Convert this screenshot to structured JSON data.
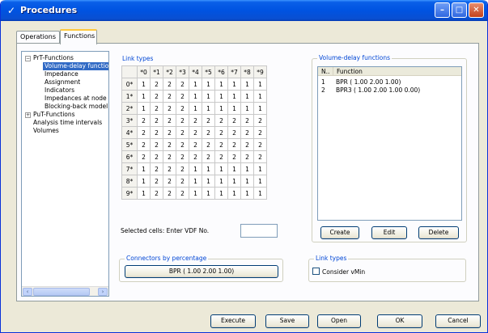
{
  "window": {
    "title": "Procedures",
    "app_icon": "procedures-app-icon"
  },
  "titlebar_buttons": {
    "minimize": "–",
    "maximize": "□",
    "close": "✕"
  },
  "tabs": [
    {
      "label": "Operations"
    },
    {
      "label": "Functions",
      "active": true
    }
  ],
  "tree": {
    "items": [
      {
        "label": "PrT-Functions",
        "expander": "−"
      },
      {
        "label": "Volume-delay functio",
        "selected": true
      },
      {
        "label": "Impedance"
      },
      {
        "label": "Assignment"
      },
      {
        "label": "Indicators"
      },
      {
        "label": "Impedances at node"
      },
      {
        "label": "Blocking-back model"
      },
      {
        "label": "PuT-Functions",
        "expander": "+"
      },
      {
        "label": "Analysis time intervals"
      },
      {
        "label": "Volumes"
      }
    ],
    "scroll_left": "‹",
    "scroll_right": "›"
  },
  "link_types": {
    "label": "Link types",
    "column_headers": [
      "*0",
      "*1",
      "*2",
      "*3",
      "*4",
      "*5",
      "*6",
      "*7",
      "*8",
      "*9"
    ],
    "row_headers": [
      "0*",
      "1*",
      "2*",
      "3*",
      "4*",
      "5*",
      "6*",
      "7*",
      "8*",
      "9*"
    ],
    "rows": [
      [
        "1",
        "2",
        "2",
        "2",
        "1",
        "1",
        "1",
        "1",
        "1",
        "1"
      ],
      [
        "1",
        "2",
        "2",
        "2",
        "1",
        "1",
        "1",
        "1",
        "1",
        "1"
      ],
      [
        "1",
        "2",
        "2",
        "2",
        "1",
        "1",
        "1",
        "1",
        "1",
        "1"
      ],
      [
        "2",
        "2",
        "2",
        "2",
        "2",
        "2",
        "2",
        "2",
        "2",
        "2"
      ],
      [
        "2",
        "2",
        "2",
        "2",
        "2",
        "2",
        "2",
        "2",
        "2",
        "2"
      ],
      [
        "2",
        "2",
        "2",
        "2",
        "2",
        "2",
        "2",
        "2",
        "2",
        "2"
      ],
      [
        "2",
        "2",
        "2",
        "2",
        "2",
        "2",
        "2",
        "2",
        "2",
        "2"
      ],
      [
        "1",
        "2",
        "2",
        "2",
        "1",
        "1",
        "1",
        "1",
        "1",
        "1"
      ],
      [
        "1",
        "2",
        "2",
        "2",
        "1",
        "1",
        "1",
        "1",
        "1",
        "1"
      ],
      [
        "1",
        "2",
        "2",
        "2",
        "1",
        "1",
        "1",
        "1",
        "1",
        "1"
      ]
    ],
    "selected_cells_label": "Selected cells: Enter VDF No.",
    "selected_cells_value": ""
  },
  "vdf": {
    "label": "Volume-delay functions",
    "columns": [
      "N..",
      "Function"
    ],
    "rows": [
      {
        "n": "1",
        "function": "BPR ( 1.00  2.00  1.00)"
      },
      {
        "n": "2",
        "function": "BPR3 ( 1.00  2.00  1.00  0.00)"
      }
    ],
    "buttons": {
      "create": "Create",
      "edit": "Edit",
      "delete": "Delete"
    }
  },
  "connectors": {
    "label": "Connectors by percentage",
    "value": "BPR ( 1.00  2.00  1.00)"
  },
  "link_types_options": {
    "label": "Link types",
    "consider_vmin": "Consider vMin"
  },
  "footer_buttons": {
    "execute": "Execute",
    "save": "Save",
    "open": "Open",
    "ok": "OK",
    "cancel": "Cancel"
  }
}
